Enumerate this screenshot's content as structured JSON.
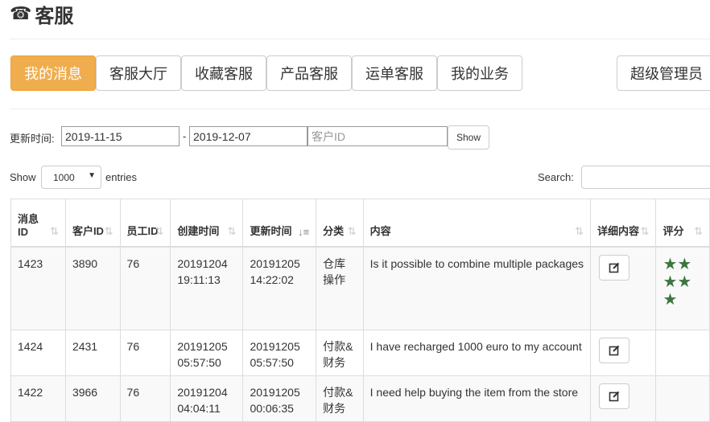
{
  "page": {
    "title": "客服",
    "title_icon": "phone-icon"
  },
  "tabs": [
    {
      "label": "我的消息",
      "active": true
    },
    {
      "label": "客服大厅",
      "active": false
    },
    {
      "label": "收藏客服",
      "active": false
    },
    {
      "label": "产品客服",
      "active": false
    },
    {
      "label": "运单客服",
      "active": false
    },
    {
      "label": "我的业务",
      "active": false
    },
    {
      "label": "超级管理员",
      "active": false
    }
  ],
  "filter": {
    "label": "更新时间:",
    "date_from": "2019-11-15",
    "separator": "-",
    "date_to": "2019-12-07",
    "customer_id_placeholder": "客户ID",
    "show_button": "Show"
  },
  "datatable": {
    "show_label": "Show",
    "page_size": "1000",
    "entries_label": "entries",
    "search_label": "Search:"
  },
  "table": {
    "headers": [
      "消息ID",
      "客户ID",
      "员工ID",
      "创建时间",
      "更新时间",
      "分类",
      "内容",
      "详细内容",
      "评分"
    ],
    "rows": [
      {
        "msg_id": "1423",
        "customer_id": "3890",
        "staff_id": "76",
        "created": "20191204 19:11:13",
        "updated": "20191205 14:22:02",
        "category": "仓库操作",
        "content": "Is it possible to combine multiple packages",
        "rating": "★★★★★"
      },
      {
        "msg_id": "1424",
        "customer_id": "2431",
        "staff_id": "76",
        "created": "20191205 05:57:50",
        "updated": "20191205 05:57:50",
        "category": "付款&财务",
        "content": "I have recharged 1000 euro to my account",
        "rating": ""
      },
      {
        "msg_id": "1422",
        "customer_id": "3966",
        "staff_id": "76",
        "created": "20191204 04:04:11",
        "updated": "20191205 00:06:35",
        "category": "付款&财务",
        "content": "I need help buying the item from the store",
        "rating": ""
      }
    ]
  },
  "colors": {
    "active_tab": "#f0ad4e",
    "star": "#3c763d"
  }
}
